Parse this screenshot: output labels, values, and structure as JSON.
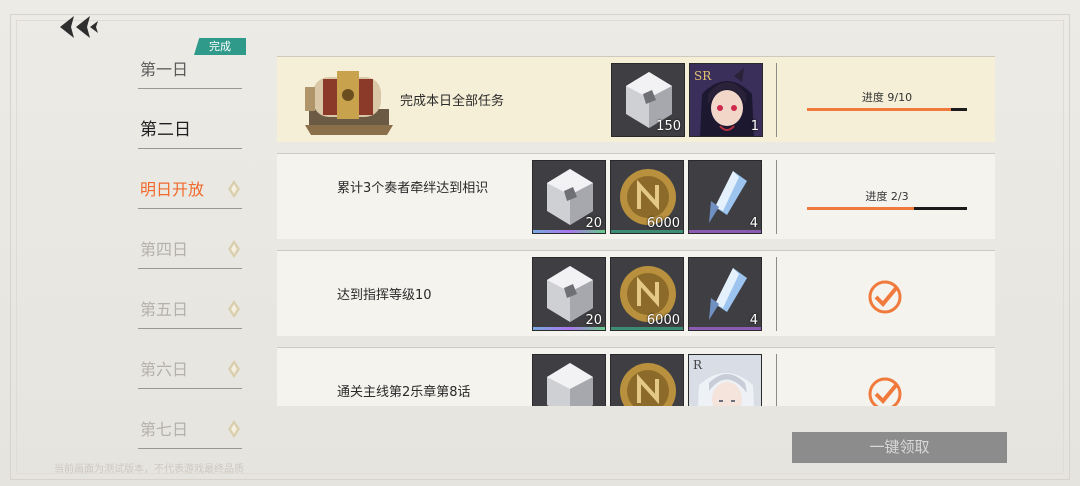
{
  "sidebar": {
    "badge": "完成",
    "days": [
      {
        "label": "第一日",
        "state": "done"
      },
      {
        "label": "第二日",
        "state": "active"
      },
      {
        "label": "明日开放",
        "state": "open"
      },
      {
        "label": "第四日",
        "state": "locked"
      },
      {
        "label": "第五日",
        "state": "locked"
      },
      {
        "label": "第六日",
        "state": "locked"
      },
      {
        "label": "第七日",
        "state": "locked"
      }
    ]
  },
  "tasks": [
    {
      "desc": "完成本日全部任务",
      "rewards": [
        {
          "icon": "crystal-icon",
          "count": "150"
        },
        {
          "icon": "sr-character-portrait",
          "rarity": "SR",
          "count": "1"
        }
      ],
      "progress_text": "进度 9/10",
      "progress": 0.9
    },
    {
      "desc": "累计3个奏者牵绊达到相识",
      "rewards": [
        {
          "icon": "crystal-icon",
          "count": "20"
        },
        {
          "icon": "coin-icon",
          "count": "6000"
        },
        {
          "icon": "shard-icon",
          "count": "4"
        }
      ],
      "progress_text": "进度 2/3",
      "progress": 0.667
    },
    {
      "desc": "达到指挥等级10",
      "rewards": [
        {
          "icon": "crystal-icon",
          "count": "20"
        },
        {
          "icon": "coin-icon",
          "count": "6000"
        },
        {
          "icon": "shard-icon",
          "count": "4"
        }
      ],
      "status": "complete"
    },
    {
      "desc": "通关主线第2乐章第8话",
      "rewards": [
        {
          "icon": "crystal-icon",
          "count": ""
        },
        {
          "icon": "coin-icon",
          "count": ""
        },
        {
          "icon": "r-character-portrait",
          "rarity": "R",
          "count": ""
        }
      ],
      "status": "complete"
    }
  ],
  "claim_all_label": "一键领取",
  "disclaimer": "当前画面为测试版本，不代表游戏最终品质",
  "colors": {
    "accent": "#f06a2c",
    "badge": "#2f9a8a",
    "highlight_row": "#f5efd7"
  }
}
